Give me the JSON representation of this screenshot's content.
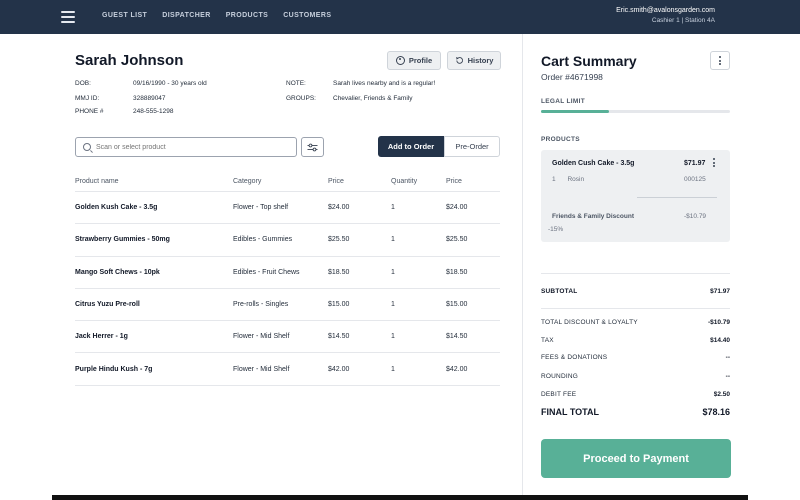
{
  "nav": {
    "links": [
      "GUEST LIST",
      "DISPATCHER",
      "PRODUCTS",
      "CUSTOMERS"
    ],
    "user_email": "Eric.smith@avalonsgarden.com",
    "station": "Cashier 1  |  Station 4A"
  },
  "customer": {
    "name": "Sarah Johnson",
    "profile_label": "Profile",
    "history_label": "History",
    "dob_label": "DOB:",
    "dob": "09/16/1990 - 30 years old",
    "mmj_label": "MMJ ID:",
    "mmj": "328889047",
    "phone_label": "PHONE #",
    "phone": "248-555-1298",
    "note_label": "NOTE:",
    "note": "Sarah lives nearby and is a regular!",
    "groups_label": "GROUPS:",
    "groups": "Chevalier, Friends & Family"
  },
  "search": {
    "placeholder": "Scan or select product"
  },
  "actions": {
    "add_label": "Add to Order",
    "preorder_label": "Pre-Order"
  },
  "table": {
    "headers": [
      "Product name",
      "Category",
      "Price",
      "Quantity",
      "Price"
    ],
    "rows": [
      [
        "Golden Kush Cake - 3.5g",
        "Flower - Top shelf",
        "$24.00",
        "1",
        "$24.00"
      ],
      [
        "Strawberry Gummies - 50mg",
        "Edibles - Gummies",
        "$25.50",
        "1",
        "$25.50"
      ],
      [
        "Mango Soft Chews - 10pk",
        "Edibles - Fruit Chews",
        "$18.50",
        "1",
        "$18.50"
      ],
      [
        "Citrus Yuzu Pre-roll",
        "Pre-rolls - Singles",
        "$15.00",
        "1",
        "$15.00"
      ],
      [
        "Jack Herrer - 1g",
        "Flower - Mid Shelf",
        "$14.50",
        "1",
        "$14.50"
      ],
      [
        "Purple Hindu Kush - 7g",
        "Flower - Mid Shelf",
        "$42.00",
        "1",
        "$42.00"
      ]
    ]
  },
  "cart": {
    "title": "Cart Summary",
    "order": "Order #4671998",
    "legal_label": "LEGAL LIMIT",
    "legal_fraction": 0.36,
    "legal_color": "#58b097",
    "products_label": "PRODUCTS",
    "item": {
      "name": "Golden Cush Cake - 3.5g",
      "price": "$71.97",
      "qty": "1",
      "variant": "Rosin",
      "code": "000125",
      "discount_name": "Friends & Family Discount",
      "discount_value": "-$10.79",
      "discount_pct": "-15%"
    },
    "subtotal_label": "SUBTOTAL",
    "subtotal": "$71.97",
    "discount_label": "TOTAL DISCOUNT & LOYALTY",
    "discount": "-$10.79",
    "tax_label": "TAX",
    "tax": "$14.40",
    "fees_label": "FEES & DONATIONS",
    "fees": "--",
    "rounding_label": "ROUNDING",
    "rounding": "--",
    "debit_label": "DEBIT FEE",
    "debit": "$2.50",
    "final_label": "FINAL TOTAL",
    "final": "$78.16",
    "pay_label": "Proceed to Payment"
  },
  "colors": {
    "nav": "#233349",
    "accent": "#58b097"
  }
}
